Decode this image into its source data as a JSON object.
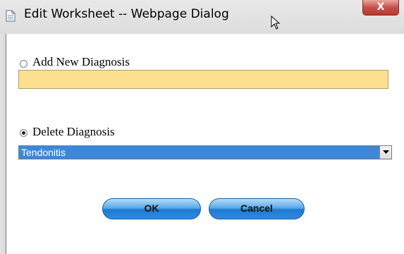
{
  "window": {
    "title": "Edit Worksheet -- Webpage Dialog",
    "close_label": "X",
    "icons": {
      "document": "document-icon",
      "cursor": "cursor-icon",
      "close": "close-icon"
    }
  },
  "form": {
    "add_option": {
      "label": "Add New Diagnosis",
      "selected": false
    },
    "add_field": {
      "value": "",
      "placeholder": "",
      "background": "#fce08f"
    },
    "delete_option": {
      "label": "Delete Diagnosis",
      "selected": true
    },
    "diagnosis_select": {
      "selected": "Tendonitis",
      "highlight": "#3f87d6"
    }
  },
  "buttons": {
    "ok_label": "OK",
    "cancel_label": "Cancel",
    "color": "#2f8ae0"
  }
}
